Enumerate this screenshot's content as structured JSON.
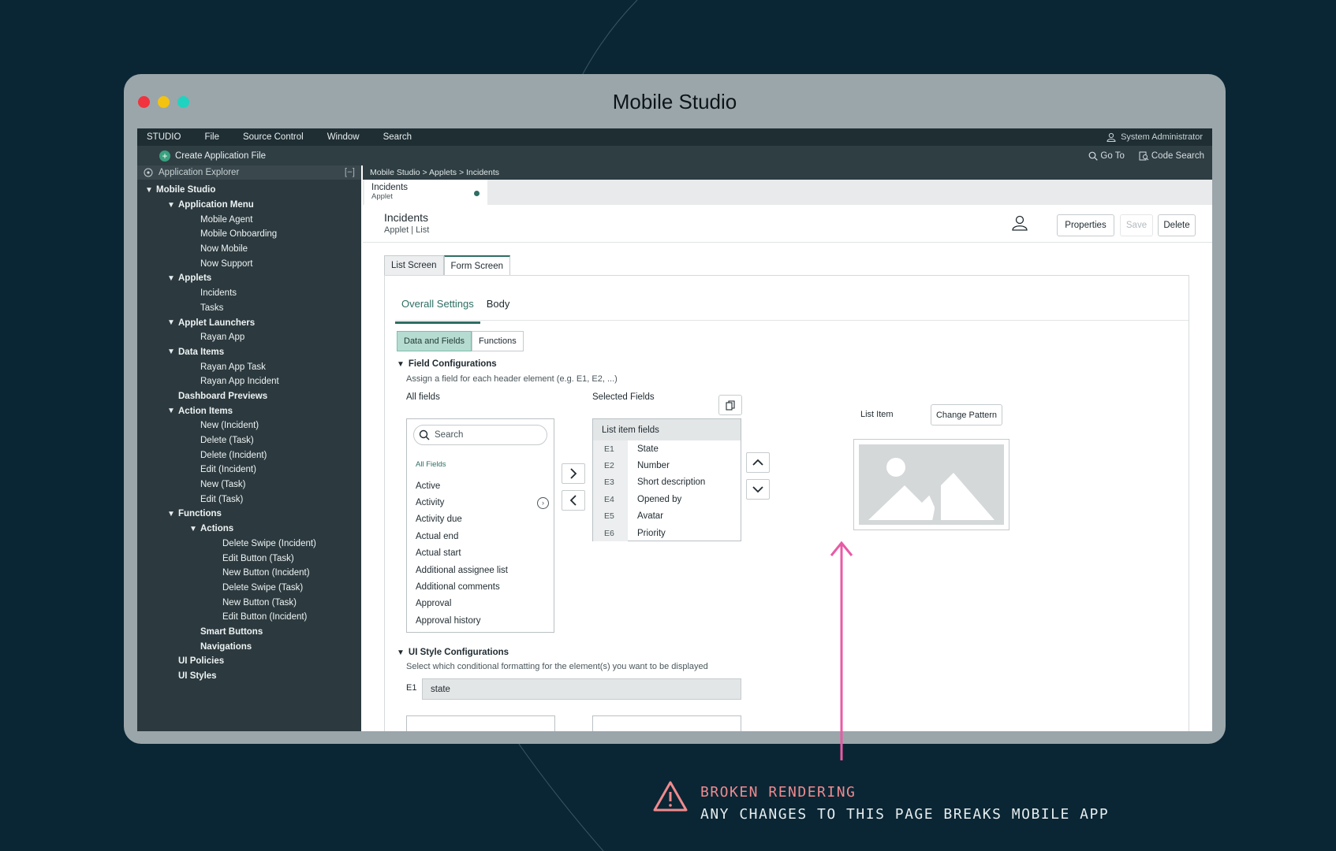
{
  "window": {
    "title": "Mobile Studio",
    "traffic_colors": [
      "#f0333f",
      "#f4c30f",
      "#1fd3c0"
    ]
  },
  "menubar": {
    "items": [
      "STUDIO",
      "File",
      "Source Control",
      "Window",
      "Search"
    ],
    "user": "System Administrator"
  },
  "toolbar": {
    "create": "Create Application File",
    "goto": "Go To",
    "code_search": "Code Search"
  },
  "explorer": {
    "title": "Application Explorer",
    "collapse": "[−]",
    "tree": [
      {
        "label": "Mobile Studio",
        "depth": 0,
        "expand": true,
        "bold": true
      },
      {
        "label": "Application Menu",
        "depth": 1,
        "expand": true,
        "bold": true
      },
      {
        "label": "Mobile Agent",
        "depth": 2
      },
      {
        "label": "Mobile Onboarding",
        "depth": 2
      },
      {
        "label": "Now Mobile",
        "depth": 2
      },
      {
        "label": "Now Support",
        "depth": 2
      },
      {
        "label": "Applets",
        "depth": 1,
        "expand": true,
        "bold": true
      },
      {
        "label": "Incidents",
        "depth": 2
      },
      {
        "label": "Tasks",
        "depth": 2
      },
      {
        "label": "Applet Launchers",
        "depth": 1,
        "expand": true,
        "bold": true
      },
      {
        "label": "Rayan App",
        "depth": 2
      },
      {
        "label": "Data Items",
        "depth": 1,
        "expand": true,
        "bold": true
      },
      {
        "label": "Rayan App Task",
        "depth": 2
      },
      {
        "label": "Rayan App Incident",
        "depth": 2
      },
      {
        "label": "Dashboard Previews",
        "depth": 1,
        "bold": true
      },
      {
        "label": "Action Items",
        "depth": 1,
        "expand": true,
        "bold": true
      },
      {
        "label": "New (Incident)",
        "depth": 2
      },
      {
        "label": "Delete (Task)",
        "depth": 2
      },
      {
        "label": "Delete (Incident)",
        "depth": 2
      },
      {
        "label": "Edit (Incident)",
        "depth": 2
      },
      {
        "label": "New (Task)",
        "depth": 2
      },
      {
        "label": "Edit (Task)",
        "depth": 2
      },
      {
        "label": "Functions",
        "depth": 1,
        "expand": true,
        "bold": true
      },
      {
        "label": "Actions",
        "depth": 2,
        "expand": true,
        "bold": true
      },
      {
        "label": "Delete Swipe (Incident)",
        "depth": 3
      },
      {
        "label": "Edit Button (Task)",
        "depth": 3
      },
      {
        "label": "New Button (Incident)",
        "depth": 3
      },
      {
        "label": "Delete Swipe (Task)",
        "depth": 3
      },
      {
        "label": "New Button (Task)",
        "depth": 3
      },
      {
        "label": "Edit Button (Incident)",
        "depth": 3
      },
      {
        "label": "Smart Buttons",
        "depth": 2,
        "bold": true
      },
      {
        "label": "Navigations",
        "depth": 2,
        "bold": true
      },
      {
        "label": "UI Policies",
        "depth": 1,
        "bold": true
      },
      {
        "label": "UI Styles",
        "depth": 1,
        "bold": true
      }
    ]
  },
  "breadcrumb": "Mobile Studio > Applets > Incidents",
  "doc_tab": {
    "title": "Incidents",
    "subtitle": "Applet"
  },
  "header": {
    "title": "Incidents",
    "subtitle": "Applet | List",
    "properties": "Properties",
    "save": "Save",
    "delete": "Delete"
  },
  "screen_tabs": [
    "List Screen",
    "Form Screen"
  ],
  "settings_tabs": [
    "Overall Settings",
    "Body"
  ],
  "segment": [
    "Data and Fields",
    "Functions"
  ],
  "field_config": {
    "heading": "Field Configurations",
    "hint": "Assign a field for each header element (e.g. E1, E2, ...)",
    "all_fields_label": "All fields",
    "search_placeholder": "Search",
    "all_fields_tag": "All Fields",
    "fields": [
      "Active",
      "Activity",
      "Activity due",
      "Actual end",
      "Actual start",
      "Additional assignee list",
      "Additional comments",
      "Approval",
      "Approval history"
    ],
    "selected_label": "Selected Fields",
    "list_item_fields": "List item fields",
    "selected": [
      {
        "code": "E1",
        "name": "State"
      },
      {
        "code": "E2",
        "name": "Number"
      },
      {
        "code": "E3",
        "name": "Short description"
      },
      {
        "code": "E4",
        "name": "Opened by"
      },
      {
        "code": "E5",
        "name": "Avatar"
      },
      {
        "code": "E6",
        "name": "Priority"
      }
    ]
  },
  "preview": {
    "label": "List Item",
    "change_pattern": "Change Pattern"
  },
  "ui_style": {
    "heading": "UI Style Configurations",
    "hint": "Select which conditional formatting for the element(s) you want to be displayed",
    "e1_label": "E1",
    "e1_value": "state"
  },
  "warning": {
    "line1": "BROKEN RENDERING",
    "line2": "ANY CHANGES TO THIS PAGE BREAKS MOBILE APP",
    "accent": "#e85aa6"
  }
}
